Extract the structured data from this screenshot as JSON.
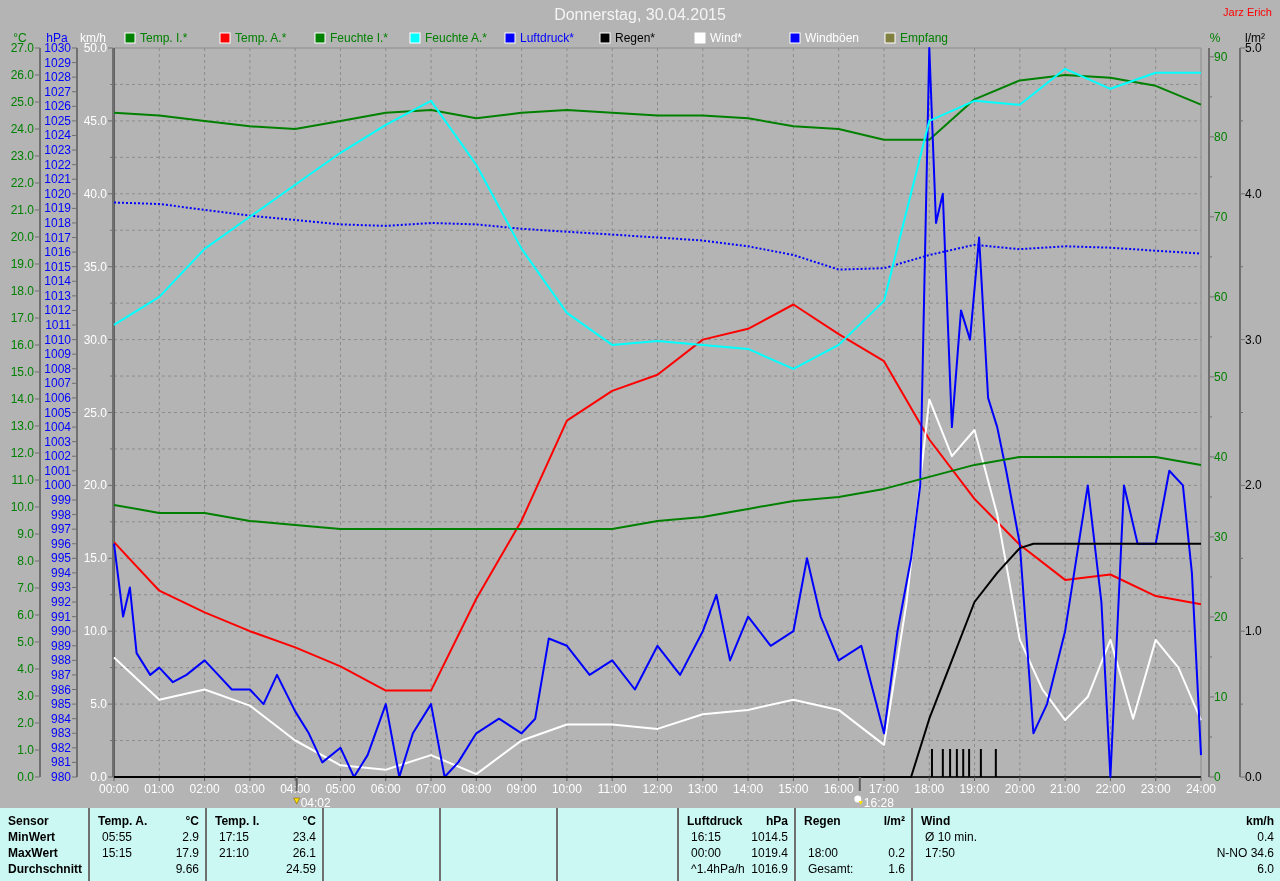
{
  "title": "Donnerstag, 30.04.2015",
  "author": "Jarz Erich",
  "chart": {
    "legend": [
      {
        "color": "#008000",
        "label": {
          "text": "Temp. I.*",
          "color": "#008000"
        }
      },
      {
        "color": "#ff0000",
        "label": {
          "text": "Temp. A.*",
          "color": "#008000"
        }
      },
      {
        "color": "#008000",
        "label": {
          "text": "Feuchte I.*",
          "color": "#008000"
        }
      },
      {
        "color": "#00ffff",
        "label": {
          "text": "Feuchte A.*",
          "color": "#008000"
        }
      },
      {
        "color": "#0000ff",
        "label": {
          "text": "Luftdruck*",
          "color": "#0000ff"
        }
      },
      {
        "color": "#000000",
        "label": {
          "text": "Regen*",
          "color": "#000000"
        }
      },
      {
        "color": "#ffffff",
        "label": {
          "text": "Wind*",
          "color": "#ffffff"
        }
      },
      {
        "color": "#0000ff",
        "label": {
          "text": "Windböen",
          "color": "#ffffff"
        }
      },
      {
        "color": "#808040",
        "label": {
          "text": "Empfang",
          "color": "#008000"
        }
      }
    ],
    "axes": [
      {
        "unit": "°C",
        "color": "#008000",
        "right": false,
        "chart_data": {
          "type": "line",
          "xlim": [
            0,
            24
          ],
          "ylim": [
            0,
            27
          ],
          "yticks": [
            {
              "value": 0,
              "label": "0.0"
            },
            {
              "value": 1,
              "label": "1.0"
            },
            {
              "value": 2,
              "label": "2.0"
            },
            {
              "value": 3,
              "label": "3.0"
            },
            {
              "value": 4,
              "label": "4.0"
            },
            {
              "value": 5,
              "label": "5.0"
            },
            {
              "value": 6,
              "label": "6.0"
            },
            {
              "value": 7,
              "label": "7.0"
            },
            {
              "value": 8,
              "label": "8.0"
            },
            {
              "value": 9,
              "label": "9.0"
            },
            {
              "value": 10,
              "label": "10.0"
            },
            {
              "value": 11,
              "label": "11.0"
            },
            {
              "value": 12,
              "label": "12.0"
            },
            {
              "value": 13,
              "label": "13.0"
            },
            {
              "value": 14,
              "label": "14.0"
            },
            {
              "value": 15,
              "label": "15.0"
            },
            {
              "value": 16,
              "label": "16.0"
            },
            {
              "value": 17,
              "label": "17.0"
            },
            {
              "value": 18,
              "label": "18.0"
            },
            {
              "value": 19,
              "label": "19.0"
            },
            {
              "value": 20,
              "label": "20.0"
            },
            {
              "value": 21,
              "label": "21.0"
            },
            {
              "value": 22,
              "label": "22.0"
            },
            {
              "value": 23,
              "label": "23.0"
            },
            {
              "value": 24,
              "label": "24.0"
            },
            {
              "value": 25,
              "label": "25.0"
            },
            {
              "value": 26,
              "label": "26.0"
            },
            {
              "value": 27,
              "label": "27.0"
            }
          ],
          "x": [
            0,
            1,
            2,
            3,
            4,
            5,
            6,
            7,
            8,
            9,
            10,
            11,
            12,
            13,
            14,
            15,
            16,
            17,
            18,
            19,
            20,
            21,
            22,
            23,
            24
          ],
          "series": [
            {
              "color": "#008000",
              "values": [
                24.6,
                24.5,
                24.3,
                24.1,
                24.0,
                24.3,
                24.6,
                24.7,
                24.4,
                24.6,
                24.7,
                24.6,
                24.5,
                24.5,
                24.4,
                24.1,
                24.0,
                23.6,
                23.6,
                25.1,
                25.8,
                26.0,
                25.9,
                25.6,
                24.9
              ]
            },
            {
              "color": "#ff0000",
              "values": [
                8.7,
                6.9,
                6.1,
                5.4,
                4.8,
                4.1,
                3.2,
                3.2,
                6.6,
                9.5,
                13.2,
                14.3,
                14.9,
                16.2,
                16.6,
                17.5,
                16.4,
                15.4,
                12.5,
                10.3,
                8.6,
                7.3,
                7.5,
                6.7,
                6.4
              ]
            }
          ]
        }
      },
      {
        "unit": "hPa",
        "color": "#0000ff",
        "right": false,
        "chart_data": {
          "type": "line",
          "xlim": [
            0,
            24
          ],
          "ylim": [
            980,
            1030
          ],
          "yticks": [
            980,
            981,
            982,
            983,
            984,
            985,
            986,
            987,
            988,
            989,
            990,
            991,
            992,
            993,
            994,
            995,
            996,
            997,
            998,
            999,
            1000,
            1001,
            1002,
            1003,
            1004,
            1005,
            1006,
            1007,
            1008,
            1009,
            1010,
            1011,
            1012,
            1013,
            1014,
            1015,
            1016,
            1017,
            1018,
            1019,
            1020,
            1021,
            1022,
            1023,
            1024,
            1025,
            1026,
            1027,
            1028,
            1029,
            1030
          ],
          "x": [
            0,
            1,
            2,
            3,
            4,
            5,
            6,
            7,
            8,
            9,
            10,
            11,
            12,
            13,
            14,
            15,
            16,
            17,
            18,
            19,
            20,
            21,
            22,
            23,
            24
          ],
          "series": [
            {
              "color": "#0000ff",
              "line_style": "dotted",
              "values": [
                1019.4,
                1019.3,
                1018.9,
                1018.5,
                1018.2,
                1017.9,
                1017.8,
                1018.0,
                1017.9,
                1017.6,
                1017.4,
                1017.2,
                1017.0,
                1016.8,
                1016.4,
                1015.8,
                1014.8,
                1014.9,
                1015.8,
                1016.5,
                1016.2,
                1016.4,
                1016.3,
                1016.1,
                1015.9
              ]
            }
          ]
        }
      },
      {
        "unit": "km/h",
        "color": "#ffffff",
        "right": false,
        "chart_data": {
          "type": "line",
          "xlim": [
            0,
            24
          ],
          "ylim": [
            0,
            50
          ],
          "yticks": [
            {
              "value": 0,
              "label": "0.0"
            },
            {
              "value": 5,
              "label": "5.0"
            },
            {
              "value": 10,
              "label": "10.0"
            },
            {
              "value": 15,
              "label": "15.0"
            },
            {
              "value": 20,
              "label": "20.0"
            },
            {
              "value": 25,
              "label": "25.0"
            },
            {
              "value": 30,
              "label": "30.0"
            },
            {
              "value": 35,
              "label": "35.0"
            },
            {
              "value": 40,
              "label": "40.0"
            },
            {
              "value": 45,
              "label": "45.0"
            },
            {
              "value": 50,
              "label": "50.0"
            }
          ],
          "xticks": [
            {
              "value": 0,
              "label": "00:00"
            },
            {
              "value": 1,
              "label": "01:00"
            },
            {
              "value": 2,
              "label": "02:00"
            },
            {
              "value": 3,
              "label": "03:00"
            },
            {
              "value": 4,
              "label": "04:00"
            },
            {
              "value": 5,
              "label": "05:00"
            },
            {
              "value": 6,
              "label": "06:00"
            },
            {
              "value": 7,
              "label": "07:00"
            },
            {
              "value": 8,
              "label": "08:00"
            },
            {
              "value": 9,
              "label": "09:00"
            },
            {
              "value": 10,
              "label": "10:00"
            },
            {
              "value": 11,
              "label": "11:00"
            },
            {
              "value": 12,
              "label": "12:00"
            },
            {
              "value": 13,
              "label": "13:00"
            },
            {
              "value": 14,
              "label": "14:00"
            },
            {
              "value": 15,
              "label": "15:00"
            },
            {
              "value": 16,
              "label": "16:00"
            },
            {
              "value": 17,
              "label": "17:00"
            },
            {
              "value": 18,
              "label": "18:00"
            },
            {
              "value": 19,
              "label": "19:00"
            },
            {
              "value": 20,
              "label": "20:00"
            },
            {
              "value": 21,
              "label": "21:00"
            },
            {
              "value": 22,
              "label": "22:00"
            },
            {
              "value": 23,
              "label": "23:00"
            },
            {
              "value": 24,
              "label": "24:00"
            }
          ],
          "series": [
            {
              "color": "#ffffff",
              "x": [
                0,
                1,
                2,
                3,
                4,
                5,
                6,
                7,
                8,
                9,
                10,
                11,
                12,
                13,
                14,
                15,
                16,
                17,
                17.5,
                18,
                18.5,
                19,
                19.5,
                20,
                20.5,
                21,
                21.5,
                22,
                22.5,
                23,
                23.5,
                24
              ],
              "values": [
                8.2,
                5.3,
                6,
                4.9,
                2.5,
                0.8,
                0.5,
                1.5,
                0.2,
                2.5,
                3.6,
                3.6,
                3.3,
                4.3,
                4.6,
                5.3,
                4.6,
                2.2,
                12,
                25.9,
                22,
                23.8,
                18,
                9.4,
                6,
                3.9,
                5.5,
                9.4,
                4,
                9.4,
                7.5,
                3.9
              ]
            },
            {
              "color": "#0000ff",
              "x": [
                0,
                0.2,
                0.35,
                0.5,
                0.8,
                1.0,
                1.3,
                1.6,
                2.0,
                2.3,
                2.6,
                3.0,
                3.3,
                3.6,
                4.0,
                4.3,
                4.6,
                5.0,
                5.3,
                5.6,
                6.0,
                6.3,
                6.6,
                7.0,
                7.3,
                7.6,
                8.0,
                8.5,
                9.0,
                9.3,
                9.6,
                10.0,
                10.5,
                11.0,
                11.5,
                12.0,
                12.5,
                13.0,
                13.3,
                13.6,
                14.0,
                14.5,
                15.0,
                15.3,
                15.6,
                16.0,
                16.5,
                17.0,
                17.3,
                17.6,
                17.8,
                18.0,
                18.15,
                18.3,
                18.5,
                18.7,
                18.9,
                19.1,
                19.3,
                19.5,
                19.7,
                20.0,
                20.3,
                20.6,
                21.0,
                21.3,
                21.5,
                21.8,
                22.0,
                22.3,
                22.6,
                23.0,
                23.3,
                23.6,
                23.8,
                24.0
              ],
              "values": [
                16,
                11,
                13,
                8.5,
                7,
                7.5,
                6.5,
                7,
                8,
                7,
                6,
                6,
                5,
                7,
                4.5,
                3,
                1,
                2,
                0,
                1.5,
                5,
                0,
                3,
                5,
                0,
                1,
                3,
                4,
                3,
                4,
                9.5,
                9,
                7,
                8,
                6,
                9,
                7,
                10,
                12.5,
                8,
                11,
                9,
                10,
                15,
                11,
                8,
                9,
                3,
                10,
                15,
                20,
                50,
                38,
                40,
                24,
                32,
                30,
                37,
                26,
                24,
                21,
                16,
                3,
                5,
                10,
                16,
                20,
                12,
                0,
                20,
                16,
                16,
                21,
                20,
                14,
                1.5
              ]
            }
          ],
          "annotations": [
            "04:02",
            "16:28"
          ]
        }
      },
      {
        "unit": "%",
        "color": "#008000",
        "right": true,
        "chart_data": {
          "type": "line",
          "xlim": [
            0,
            24
          ],
          "ylim": [
            0,
            91.1
          ],
          "yticks": [
            0,
            10,
            20,
            30,
            40,
            50,
            60,
            70,
            80,
            90
          ],
          "x": [
            0,
            1,
            2,
            3,
            4,
            5,
            6,
            7,
            8,
            9,
            10,
            11,
            12,
            13,
            14,
            15,
            16,
            17,
            18,
            19,
            20,
            21,
            22,
            23,
            24
          ],
          "series": [
            {
              "color": "#008000",
              "values": [
                34,
                33,
                33,
                32,
                31.5,
                31,
                31,
                31,
                31,
                31,
                31,
                31,
                32,
                32.5,
                33.5,
                34.5,
                35,
                36,
                37.5,
                39,
                40,
                40,
                40,
                40,
                39
              ]
            },
            {
              "color": "#00ffff",
              "values": [
                56.5,
                60,
                66,
                70,
                74,
                78,
                81.5,
                84.5,
                76.5,
                66,
                58,
                54,
                54.5,
                54,
                53.5,
                51,
                54,
                59.5,
                82,
                84.5,
                84,
                88.5,
                86,
                88,
                88
              ]
            }
          ]
        }
      },
      {
        "unit": "l/m²",
        "color": "#000000",
        "right": true,
        "chart_data": {
          "type": "line",
          "xlim": [
            0,
            24
          ],
          "ylim": [
            0,
            5
          ],
          "yticks": [
            {
              "value": 0,
              "label": "0.0"
            },
            {
              "value": 1,
              "label": "1.0"
            },
            {
              "value": 2,
              "label": "2.0"
            },
            {
              "value": 3,
              "label": "3.0"
            },
            {
              "value": 4,
              "label": "4.0"
            },
            {
              "value": 5,
              "label": "5.0"
            }
          ],
          "series": [
            {
              "color": "#000000",
              "x": [
                0,
                17.6,
                18,
                18.5,
                19,
                19.5,
                20,
                20.3,
                20.6,
                24
              ],
              "values": [
                0,
                0,
                0.4,
                0.8,
                1.2,
                1.4,
                1.57,
                1.6,
                1.6,
                1.6
              ]
            }
          ]
        }
      }
    ]
  },
  "summary": {
    "row_labels": [
      "Sensor",
      "MinWert",
      "MaxWert",
      "Durchschnitt"
    ],
    "columns": [
      {
        "kind": "sensor",
        "name": "Temp. A.",
        "unit": "°C",
        "rows": [
          {
            "time": "05:55",
            "value": "2.9"
          },
          {
            "time": "15:15",
            "value": "17.9"
          },
          {
            "value": "9.66"
          }
        ]
      },
      {
        "kind": "sensor",
        "name": "Temp. I.",
        "unit": "°C",
        "rows": [
          {
            "time": "17:15",
            "value": "23.4"
          },
          {
            "time": "21:10",
            "value": "26.1"
          },
          {
            "value": "24.59"
          }
        ]
      },
      {
        "kind": "empty"
      },
      {
        "kind": "empty"
      },
      {
        "kind": "empty"
      },
      {
        "kind": "sensor",
        "name": "Luftdruck",
        "unit": "hPa",
        "rows": [
          {
            "time": "16:15",
            "value": "1014.5"
          },
          {
            "time": "00:00",
            "value": "1019.4"
          },
          {
            "time": "^1.4hPa/h",
            "value": "1016.9"
          }
        ]
      },
      {
        "kind": "sensor",
        "name": "Regen",
        "unit": "l/m²",
        "rows": [
          {},
          {
            "time": "18:00",
            "value": "0.2"
          },
          {
            "time": "Gesamt:",
            "value": "1.6"
          }
        ]
      },
      {
        "kind": "sensor",
        "name": "Wind",
        "unit": "km/h",
        "rows": [
          {
            "time": "Ø 10 min.",
            "value": "0.4"
          },
          {
            "time": "17:50",
            "value": "N-NO 34.6"
          },
          {
            "value": "6.0"
          }
        ]
      }
    ]
  }
}
